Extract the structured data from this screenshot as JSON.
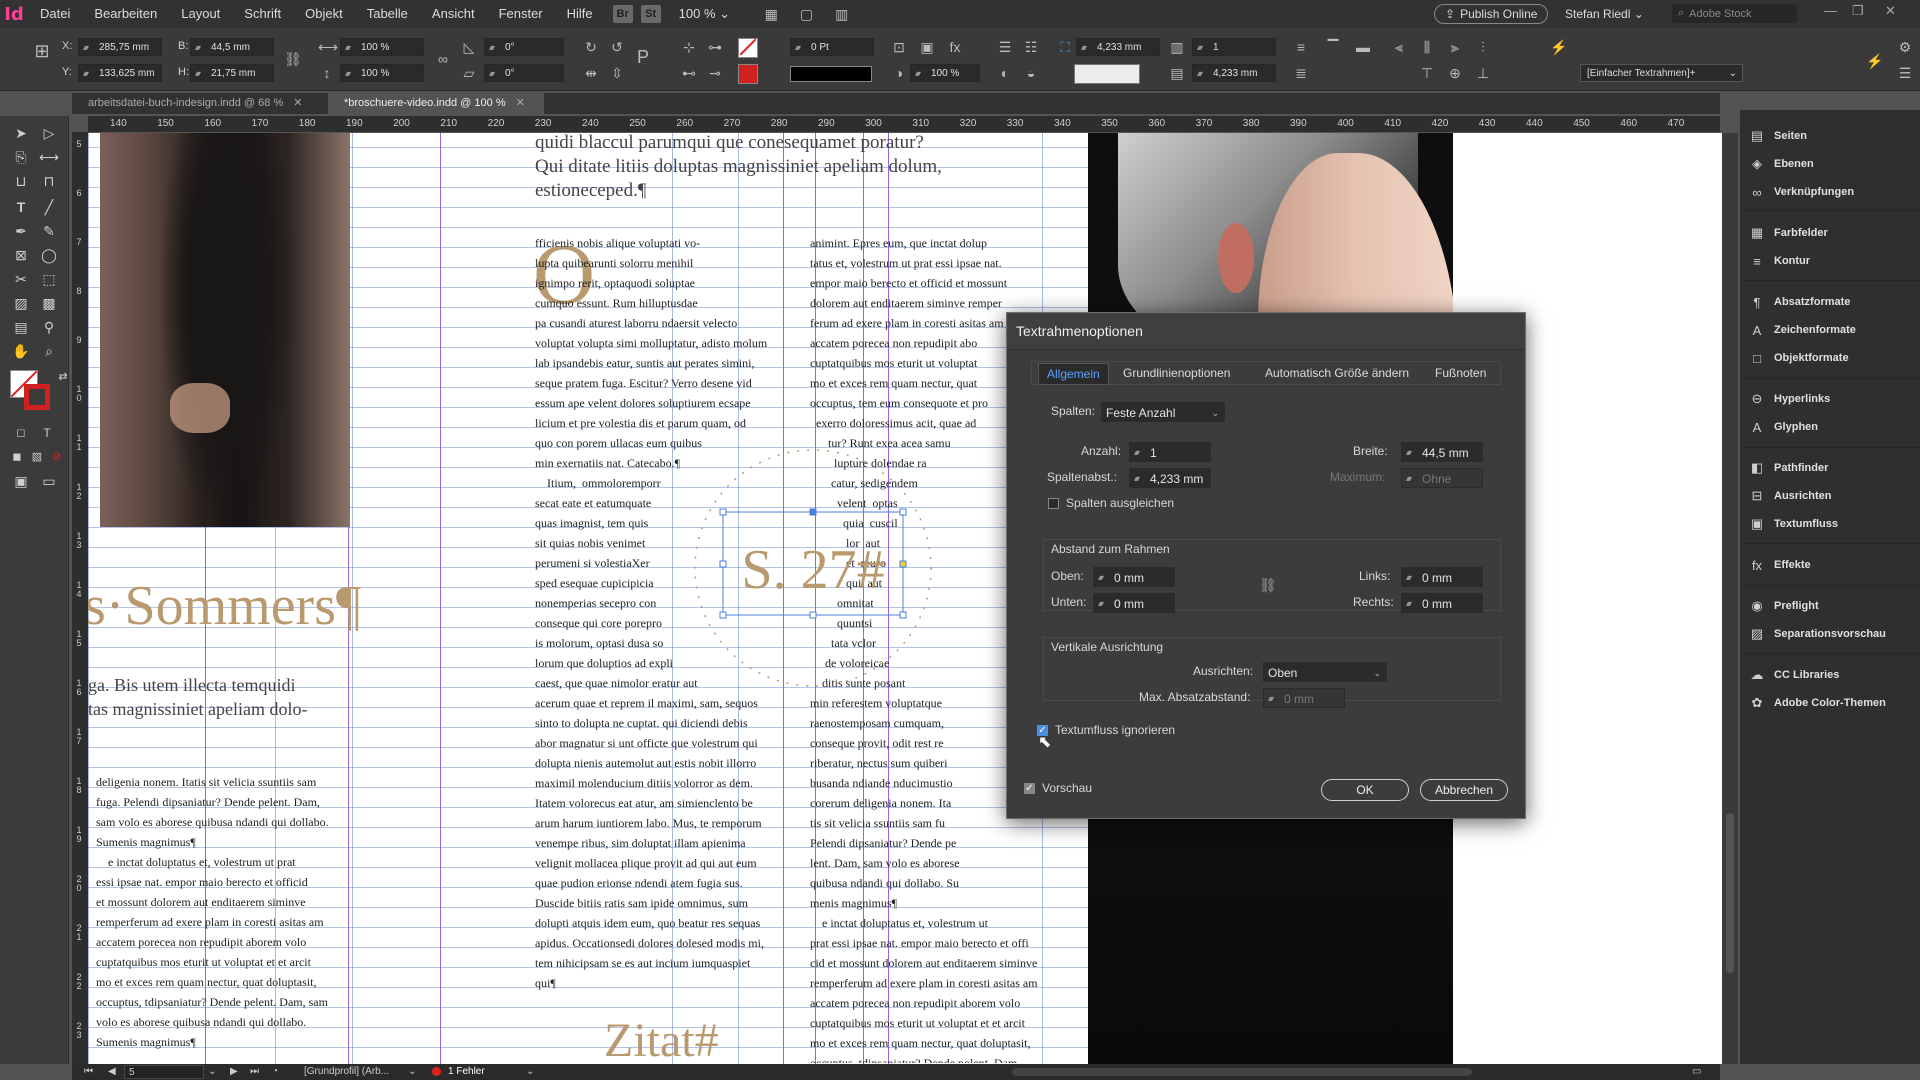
{
  "app": {
    "logo": "Id",
    "menu": [
      "Datei",
      "Bearbeiten",
      "Layout",
      "Schrift",
      "Objekt",
      "Tabelle",
      "Ansicht",
      "Fenster",
      "Hilfe"
    ],
    "badges": [
      "Br",
      "St"
    ],
    "zoom": "100 %",
    "publish_label": "Publish Online",
    "user": "Stefan Riedl",
    "stock_placeholder": "Adobe Stock"
  },
  "control": {
    "x": "285,75 mm",
    "y": "133,625 mm",
    "w": "44,5 mm",
    "h": "21,75 mm",
    "scale_x": "100 %",
    "scale_y": "100 %",
    "angle": "0°",
    "shear": "0°",
    "stroke_weight": "0 Pt",
    "opacity": "100 %",
    "spacing_a": "4,233 mm",
    "spacing_b": "4,233 mm",
    "columns": "1",
    "para_style": "[Einfacher Textrahmen]+"
  },
  "tabs": [
    {
      "label": "arbeitsdatei-buch-indesign.indd @ 68 %"
    },
    {
      "label": "*broschuere-video.indd @ 100 %"
    }
  ],
  "ruler": {
    "top": [
      "140",
      "150",
      "160",
      "170",
      "180",
      "190",
      "200",
      "210",
      "220",
      "230",
      "240",
      "250",
      "260",
      "270",
      "280",
      "290",
      "300",
      "310",
      "320",
      "330",
      "340",
      "350",
      "360",
      "370",
      "380",
      "390",
      "400",
      "410",
      "420",
      "430",
      "440",
      "450",
      "460",
      "470"
    ],
    "left": [
      "5",
      "6",
      "7",
      "8",
      "9",
      "10",
      "11",
      "12",
      "13",
      "14",
      "15",
      "16",
      "17",
      "18",
      "19",
      "20",
      "21",
      "22",
      "23"
    ]
  },
  "document": {
    "heading": "s·Sommers¶",
    "subhead": "ga. Bis utem illecta temquidi\ntas magnissiniet apeliam dolo-",
    "intro": "quidi blaccul parumqui que conesequamet poratur?\nQui ditate litiis doluptas magnissiniet apeliam dolum,\nestioneceped.¶",
    "dropcap": "O",
    "col1": "fficienis nobis alique voluptati vo-\nlupta quibearunti solorru menihil\nignimpo rerit, optaquodi soluptae\ncumquo essunt. Rum hilluptusdae\npa cusandi aturest laborru ndaersit velecto\nvoluptat volupta simi molluptatur, adisto molum\nlab ipsandebis eatur, suntis aut perates simini,\nseque pratem fuga. Escitur? Verro desene vid\nessum ape velent dolores soluptiurem ecsape\nlicium et pre volestia dis et parum quam, od\nquo con porem ullacas eum quibus\nmin exernatiis nat. Catecabo.¶\n    Itium,  ommoloremporr\nsecat eate et eatumquate\nquas imagnist, tem quis\nsit quias nobis venimet\nperumeni si volestiaXer\nsped esequae cupicipicia\nnonemperias secepro con\nconseque qui core porepro\nis molorum, optasi dusa so\nlorum que doluptios ad expli\ncaest, que quae nimolor eratur aut\nacerum quae et reprem il maximi, sam, sequos\nsinto to dolupta ne cuptat. qui diciendi debis\nabor magnatur si unt officte que volestrum qui\ndolupta nienis autemolut aut estis nobit illorro\nmaximil molenducium ditiis volorror as dem.\nItatem volorecus eat atur, am simienclento be\narum harum iuntiorem labo. Mus, te remporum\nvenempe ribus, sim doluptat illam apienima\nvelignit mollacea plique provit ad qui aut eum\nquae pudion erionse ndendi atem fugia sus.\nDuscide bitiis ratis sam ipide omnimus, sum\ndolupti atquis idem eum, quo beatur res sequas\napidus. Occationsedi dolores dolesed modis mi,\ntem nihicipsam se es aut incium iumquaspiet\nqui¶",
    "col2": "animint. Epres eum, que inctat dolup\ntatus et, volestrum ut prat essi ipsae nat.\nempor maio berecto et officid et mossunt\ndolorem aut enditaerem siminve remper\nferum ad exere plam in coresti asitas am\naccatem porecea non repudipit abo\ncuptatquibus mos eturit ut voluptat\nmo et exces rem quam nectur, quat\noccuptus, tem eum consequote et pro\n  exerro doloressimus acit, quae ad\n      tur? Runt exea acea samu\n        lupture dolendae ra\n       catur, sedigendem\n         velent  optas\n           quia  cuscil\n            lor  aut\n            et  reuro\n            qui  aut\n         omnitat\n         quuntsi\n       tata vclor\n     de voloreicae\n    ditis sunte posant\nmin referestem voluptatque\nraenostemposam cumquam,\nconseque provit, odit rest re\nriberatur, nectus sum quiberi\nbusanda ndiande nducimustio\ncorerum deligenia nonem. Ita\ntis sit velicia ssuntiis sam fu\nPelendi dipsaniatur? Dende pe\nlent. Dam, sam volo es aborese\nquibusa ndandi qui dollabo. Su\nmenis magnimus¶\n    e inctat doluptatus et, volestrum ut\nprat essi ipsae nat. empor maio berecto et offi\ncid et mossunt dolorem aut enditaerem siminve\nremperferum ad exere plam in coresti asitas am\naccatem porecea non repudipit aborem volo\ncuptatquibus mos eturit ut voluptat et et arcit\nmo et exces rem quam nectur, quat doluptasit,\noccuptus, tdipsaniatur? Dende polent. Dam,",
    "left_body": "deligenia nonem. Itatis sit velicia ssuntiis sam\nfuga. Pelendi dipsaniatur? Dende pelent. Dam,\nsam volo es aborese quibusa ndandi qui dollabo.\nSumenis magnimus¶\n    e inctat doluptatus et, volestrum ut prat\nessi ipsae nat. empor maio berecto et officid\net mossunt dolorem aut enditaerem siminve\nremperferum ad exere plam in coresti asitas am\naccatem porecea non repudipit aborem volo\ncuptatquibus mos eturit ut voluptat et et arcit\nmo et exces rem quam nectur, quat doluptasit,\noccuptus, tdipsaniatur? Dende pelent. Dam, sam\nvolo es aborese quibusa ndandi qui dollabo.\nSumenis magnimus¶",
    "circle_text": "S. 27#",
    "zitat": "Zitat#"
  },
  "panels": [
    {
      "label": "Seiten",
      "icon": "pages-icon",
      "glyph": "▤"
    },
    {
      "label": "Ebenen",
      "icon": "layers-icon",
      "glyph": "◈"
    },
    {
      "label": "Verknüpfungen",
      "icon": "links-icon",
      "glyph": "∞"
    },
    {
      "label": "Farbfelder",
      "icon": "swatches-icon",
      "glyph": "▦"
    },
    {
      "label": "Kontur",
      "icon": "stroke-icon",
      "glyph": "≡"
    },
    {
      "label": "Absatzformate",
      "icon": "paragraph-styles-icon",
      "glyph": "¶"
    },
    {
      "label": "Zeichenformate",
      "icon": "character-styles-icon",
      "glyph": "A"
    },
    {
      "label": "Objektformate",
      "icon": "object-styles-icon",
      "glyph": "□"
    },
    {
      "label": "Hyperlinks",
      "icon": "hyperlinks-icon",
      "glyph": "⊖"
    },
    {
      "label": "Glyphen",
      "icon": "glyphs-icon",
      "glyph": "A"
    },
    {
      "label": "Pathfinder",
      "icon": "pathfinder-icon",
      "glyph": "◧"
    },
    {
      "label": "Ausrichten",
      "icon": "align-icon",
      "glyph": "⊟"
    },
    {
      "label": "Textumfluss",
      "icon": "text-wrap-icon",
      "glyph": "▣"
    },
    {
      "label": "Effekte",
      "icon": "effects-icon",
      "glyph": "fx"
    },
    {
      "label": "Preflight",
      "icon": "preflight-icon",
      "glyph": "◉"
    },
    {
      "label": "Separationsvorschau",
      "icon": "separations-icon",
      "glyph": "▨"
    },
    {
      "label": "CC Libraries",
      "icon": "cc-libraries-icon",
      "glyph": "☁"
    },
    {
      "label": "Adobe Color-Themen",
      "icon": "color-themes-icon",
      "glyph": "✿"
    }
  ],
  "status": {
    "page": "5",
    "profile": "[Grundprofil] (Arb...",
    "errors": "1 Fehler"
  },
  "dialog": {
    "title": "Textrahmenoptionen",
    "tabs": [
      "Allgemein",
      "Grundlinienoptionen",
      "Automatisch Größe ändern",
      "Fußnoten"
    ],
    "spalten_label": "Spalten:",
    "spalten_value": "Feste Anzahl",
    "anzahl_label": "Anzahl:",
    "anzahl_value": "1",
    "breite_label": "Breite:",
    "breite_value": "44,5 mm",
    "abstand_label": "Spaltenabst.:",
    "abstand_value": "4,233 mm",
    "maximum_label": "Maximum:",
    "maximum_value": "Ohne",
    "ausgleichen_label": "Spalten ausgleichen",
    "rahmen_heading": "Abstand zum Rahmen",
    "oben_label": "Oben:",
    "oben_value": "0 mm",
    "unten_label": "Unten:",
    "unten_value": "0 mm",
    "links_label": "Links:",
    "links_value": "0 mm",
    "rechts_label": "Rechts:",
    "rechts_value": "0 mm",
    "vertikal_heading": "Vertikale Ausrichtung",
    "ausrichten_label": "Ausrichten:",
    "ausrichten_value": "Oben",
    "max_abs_label": "Max. Absatzabstand:",
    "max_abs_value": "0 mm",
    "textumfluss_label": "Textumfluss ignorieren",
    "vorschau_label": "Vorschau",
    "ok_label": "OK",
    "cancel_label": "Abbrechen"
  }
}
